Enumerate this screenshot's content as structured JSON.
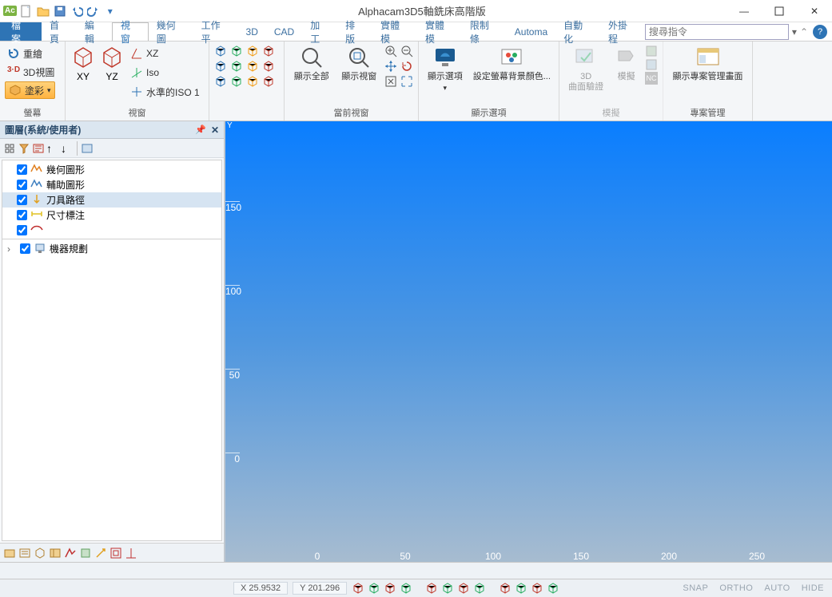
{
  "app": {
    "title": "Alphacam3D5軸銑床高階版"
  },
  "qat": {
    "new": "new-doc",
    "open": "open-doc",
    "save": "save-doc",
    "undo": "undo",
    "redo": "redo",
    "down": "▾"
  },
  "tabs": {
    "file": "檔案",
    "items": [
      "首頁",
      "編輯",
      "視窗",
      "幾何圖",
      "工作平",
      "3D",
      "CAD",
      "加工",
      "排版",
      "實體模",
      "實體模",
      "限制條",
      "Automa",
      "自動化",
      "外掛程"
    ],
    "active_index": 2
  },
  "search": {
    "placeholder": "搜尋指令"
  },
  "ribbon": {
    "groups": [
      {
        "label": "螢幕",
        "items": {
          "redraw": "重繪",
          "view3d": "3D視圖",
          "render": "塗彩"
        }
      },
      {
        "label": "視窗",
        "items": {
          "xy": "XY",
          "yz": "YZ",
          "xz": "XZ",
          "iso": "Iso",
          "leveliso": "水準的ISO 1"
        }
      },
      {
        "label": "當前視窗",
        "items": {
          "all": "顯示全部",
          "win": "顯示視窗"
        }
      },
      {
        "label": "顯示選項",
        "items": {
          "opt": "顯示選項",
          "bg": "設定螢幕背景顏色..."
        }
      },
      {
        "label": "模擬",
        "items": {
          "surf": "3D\n曲面驗證",
          "sim": "模擬"
        }
      },
      {
        "label": "專案管理",
        "items": {
          "proj": "顯示專案管理畫面"
        }
      }
    ]
  },
  "panel": {
    "title": "圖層(系統/使用者)",
    "tree": {
      "section1": [
        {
          "label": "幾何圖形",
          "sel": false
        },
        {
          "label": "輔助圖形",
          "sel": false
        },
        {
          "label": "刀具路徑",
          "sel": true
        },
        {
          "label": "尺寸標注",
          "sel": false
        }
      ],
      "section2": [
        {
          "label": "機器規劃",
          "sel": false
        }
      ]
    }
  },
  "viewport": {
    "y_label": "Y",
    "y_ticks": [
      150,
      100,
      50,
      0
    ],
    "x_ticks": [
      0,
      50,
      100,
      150,
      200,
      250
    ]
  },
  "status": {
    "x": "X 25.9532",
    "y": "Y 201.296",
    "toggles": [
      "SNAP",
      "ORTHO",
      "AUTO",
      "HIDE"
    ]
  }
}
